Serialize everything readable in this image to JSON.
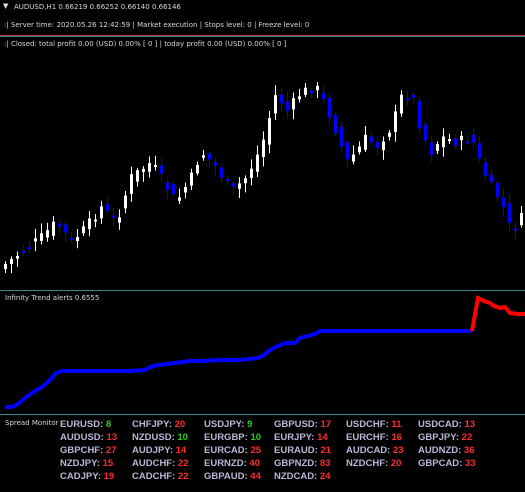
{
  "window": {
    "title": "AUDUSD,H1  0.66219 0.66252 0.66140 0.66146"
  },
  "info_bar": {
    "text": ":| Server time: 2020.05.26 12:42:59  |  Market execution  |  Stops level: 0  |  Freeze level: 0"
  },
  "profit_bar": {
    "text": ":| Closed: total profit 0.00 (USD)  0.00% [ 0 ]  |  today profit 0.00 (USD)  0.00% [ 0 ]"
  },
  "indicator": {
    "label": "Infinity Trend alerts 0.6555",
    "colors": {
      "up": "#0000ff",
      "down": "#ff0000"
    }
  },
  "spread_monitor": {
    "title": "Spread Monitor",
    "colors": {
      "low": "#22cc22",
      "high": "#ff2b2b",
      "symbol": "#b8b8d8"
    },
    "columns": [
      [
        {
          "sym": "EURUSD:",
          "val": "8",
          "level": "low"
        },
        {
          "sym": "AUDUSD:",
          "val": "13",
          "level": "high"
        },
        {
          "sym": "GBPCHF:",
          "val": "27",
          "level": "high"
        },
        {
          "sym": "NZDJPY:",
          "val": "15",
          "level": "high"
        },
        {
          "sym": "CADJPY:",
          "val": "19",
          "level": "high"
        }
      ],
      [
        {
          "sym": "CHFJPY:",
          "val": "20",
          "level": "high"
        },
        {
          "sym": "NZDUSD:",
          "val": "10",
          "level": "low"
        },
        {
          "sym": "AUDJPY:",
          "val": "14",
          "level": "high"
        },
        {
          "sym": "AUDCHF:",
          "val": "22",
          "level": "high"
        },
        {
          "sym": "CADCHF:",
          "val": "22",
          "level": "high"
        }
      ],
      [
        {
          "sym": "USDJPY:",
          "val": "9",
          "level": "low"
        },
        {
          "sym": "EURGBP:",
          "val": "10",
          "level": "low"
        },
        {
          "sym": "EURCAD:",
          "val": "25",
          "level": "high"
        },
        {
          "sym": "EURNZD:",
          "val": "40",
          "level": "high"
        },
        {
          "sym": "GBPAUD:",
          "val": "44",
          "level": "high"
        }
      ],
      [
        {
          "sym": "GBPUSD:",
          "val": "17",
          "level": "high"
        },
        {
          "sym": "EURJPY:",
          "val": "14",
          "level": "high"
        },
        {
          "sym": "EURAUD:",
          "val": "21",
          "level": "high"
        },
        {
          "sym": "GBPNZD:",
          "val": "83",
          "level": "high"
        },
        {
          "sym": "NZDCAD:",
          "val": "24",
          "level": "high"
        }
      ],
      [
        {
          "sym": "USDCHF:",
          "val": "11",
          "level": "high"
        },
        {
          "sym": "EURCHF:",
          "val": "16",
          "level": "high"
        },
        {
          "sym": "AUDCAD:",
          "val": "23",
          "level": "high"
        },
        {
          "sym": "NZDCHF:",
          "val": "20",
          "level": "high"
        }
      ],
      [
        {
          "sym": "USDCAD:",
          "val": "13",
          "level": "high"
        },
        {
          "sym": "GBPJPY:",
          "val": "22",
          "level": "high"
        },
        {
          "sym": "AUDNZD:",
          "val": "36",
          "level": "high"
        },
        {
          "sym": "GBPCAD:",
          "val": "33",
          "level": "high"
        }
      ]
    ]
  },
  "candles": {
    "colors": {
      "bull": "#ffffff",
      "bear": "#0000ff"
    }
  }
}
